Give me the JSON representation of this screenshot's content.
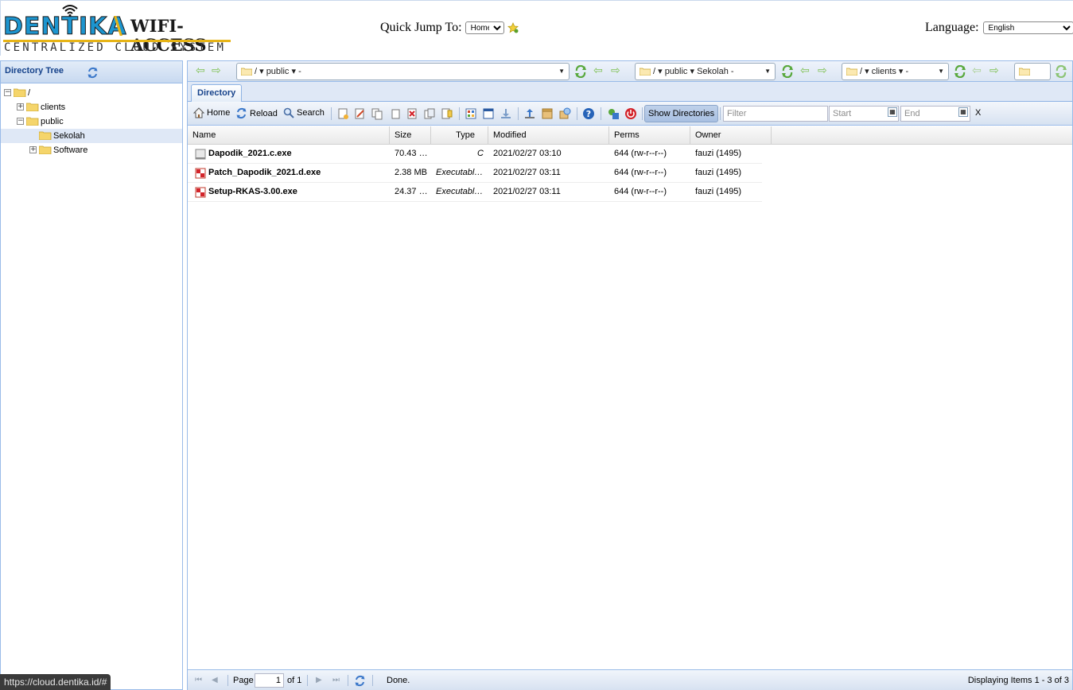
{
  "logo": {
    "main": "DENTIKA",
    "slash": "\\",
    "wifi": "WIFI-ACCESS",
    "sub": "CENTRALIZED CLOUD SYSTEM"
  },
  "header": {
    "quick_jump_label": "Quick Jump To:",
    "quick_jump_value": "Home",
    "language_label": "Language:",
    "language_value": "English"
  },
  "left_panel": {
    "title": "Directory Tree",
    "tree": [
      {
        "label": "/",
        "expander": "−"
      },
      {
        "label": "clients",
        "expander": "+"
      },
      {
        "label": "public",
        "expander": "−"
      },
      {
        "label": "Sekolah",
        "expander": ""
      },
      {
        "label": "Software",
        "expander": "+"
      }
    ]
  },
  "path_bar": {
    "pane1": "/  ▾   public  ▾  -",
    "pane2": "/  ▾   public  ▾   Sekolah -",
    "pane3": "/  ▾   clients  ▾  -",
    "dropdown_arrow": "▼"
  },
  "tabs": {
    "directory": "Directory"
  },
  "toolbar": {
    "home": "Home",
    "reload": "Reload",
    "search": "Search",
    "show_directories": "Show Directories",
    "filter_placeholder": "Filter",
    "start_placeholder": "Start",
    "end_placeholder": "End",
    "clear": "X"
  },
  "grid": {
    "columns": [
      "Name",
      "Size",
      "Type",
      "Modified",
      "Perms",
      "Owner"
    ],
    "rows": [
      {
        "name": "Dapodik_2021.c.exe",
        "size": "70.43 …",
        "type": "C",
        "modified": "2021/02/27 03:10",
        "perms": "644 (rw-r--r--)",
        "owner": "fauzi (1495)"
      },
      {
        "name": "Patch_Dapodik_2021.d.exe",
        "size": "2.38 MB",
        "type": "Executabl…",
        "modified": "2021/02/27 03:11",
        "perms": "644 (rw-r--r--)",
        "owner": "fauzi (1495)"
      },
      {
        "name": "Setup-RKAS-3.00.exe",
        "size": "24.37 …",
        "type": "Executabl…",
        "modified": "2021/02/27 03:11",
        "perms": "644 (rw-r--r--)",
        "owner": "fauzi (1495)"
      }
    ]
  },
  "paging": {
    "page_label": "Page",
    "page_value": "1",
    "of_label": "of 1",
    "status": "Done.",
    "display": "Displaying Items 1 - 3 of 3"
  },
  "browser_status": "https://cloud.dentika.id/#",
  "colors": {
    "accent": "#15428b",
    "border": "#99bbe8",
    "logo_blue": "#1d95cf",
    "logo_yellow": "#e7b416"
  }
}
